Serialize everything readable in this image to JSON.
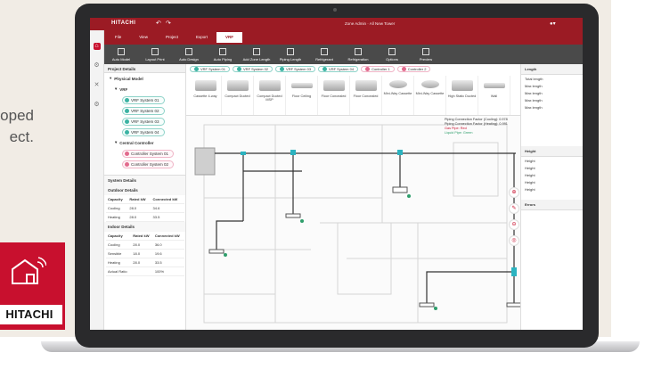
{
  "marketing": {
    "tagline_lines": [
      "oped",
      "ect."
    ],
    "brand_name": "HITACHI",
    "colors": {
      "brand_red": "#c8102e",
      "app_red": "#9b1b24",
      "teal": "#3bb3a3"
    }
  },
  "app": {
    "logo": "HITACHI",
    "document_title": "Zone Admin · All New Tower",
    "menu_tabs": [
      "File",
      "View",
      "Project",
      "Export",
      "VRF"
    ],
    "active_tab_index": 4,
    "toolbar": [
      "Auto Model",
      "Layout Print",
      "Auto Design",
      "Auto Piping",
      "Add Zone Length",
      "Piping Length",
      "Refrigerant",
      "Refrigeration",
      "Options",
      "Preview"
    ],
    "left_panel": {
      "header": "Project Details",
      "physical_header": "Physical Model",
      "vrf_label": "VRF",
      "systems": [
        "VRF System 01",
        "VRF System 02",
        "VRF System 03",
        "VRF System 04"
      ],
      "controller_header": "Central Controller",
      "controllers": [
        "Controller System 01",
        "Controller System 02"
      ],
      "system_details": "System Details",
      "outdoor_header": "Outdoor Details",
      "outdoor_table": {
        "headers": [
          "Capacity",
          "Rated kW",
          "Connected kW"
        ],
        "rows": [
          [
            "Cooling",
            "28.0",
            "34.6"
          ],
          [
            "Heating",
            "28.0",
            "33.5"
          ]
        ]
      },
      "indoor_header": "Indoor Details",
      "indoor_table": {
        "headers": [
          "Capacity",
          "Rated kW",
          "Connected kW"
        ],
        "rows": [
          [
            "Cooling",
            "28.0",
            "36.0"
          ],
          [
            "Sensible",
            "18.0",
            "19.6"
          ],
          [
            "Heating",
            "28.0",
            "33.5"
          ]
        ]
      },
      "actual_ratio_label": "Actual Ratio",
      "actual_ratio_value": "100%"
    },
    "system_tabs": [
      "VRF System 01",
      "VRF System 02",
      "VRF System 03",
      "VRF System 04",
      "Controller 1",
      "Controller 2"
    ],
    "units": [
      "Cassette 4-way",
      "Compact Ducted",
      "Compact Ducted MSP",
      "Floor Ceiling",
      "Floor Concealed",
      "Floor Concealed",
      "Mini-Way Cassette",
      "Mini-Way Cassette",
      "High Static Ducted",
      "Wall"
    ],
    "right_panel": {
      "length_header": "Length",
      "length_lines": [
        "Total length",
        "Max length",
        "Max length",
        "Max length",
        "Max length"
      ],
      "height_header": "Height",
      "height_lines": [
        "Height",
        "Height",
        "Height",
        "Height",
        "Height"
      ],
      "error_label": "Errors"
    },
    "canvas_notes": {
      "piping1": "Piping Connection Factor (Cooling): 0.978",
      "piping2": "Piping Connection Factor (Heating): 0.991",
      "gas": "Gas Pipe: Red",
      "liquid": "Liquid Pipe: Green"
    }
  }
}
